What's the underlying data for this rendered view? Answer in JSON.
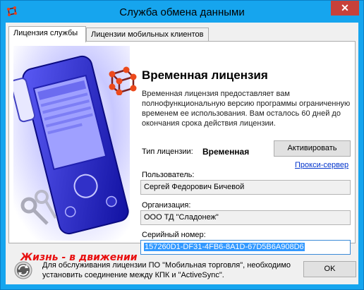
{
  "window": {
    "title": "Служба обмена данными",
    "close_glyph": "✕"
  },
  "tabs": [
    {
      "label": "Лицензия службы",
      "active": true
    },
    {
      "label": "Лицензии мобильных клиентов",
      "active": false
    }
  ],
  "license": {
    "heading": "Временная лицензия",
    "description": "Временная лицензия предоставляет вам полнофункциональную версию программы ограниченную временем ее использования. Вам осталось 60 дней до окончания срока действия лицензии.",
    "type_label": "Тип лицензии:",
    "type_value": "Временная",
    "activate_button": "Активировать",
    "proxy_link": "Прокси-сервер",
    "user_label": "Пользователь:",
    "user_value": "Сергей Федорович Бичевой",
    "org_label": "Организация:",
    "org_value": "ООО ТД \"Сладонеж\"",
    "serial_label": "Серийный номер:",
    "serial_value": "157260D1-DF31-4FB6-8A1D-67D5B6A908D6"
  },
  "art": {
    "slogan": "Жизнь - в движении"
  },
  "footer": {
    "info_text": "Для обслуживания лицензии ПО \"Мобильная торговля\", необходимо установить соединение между КПК и \"ActiveSync\".",
    "ok_button": "OK"
  },
  "colors": {
    "titlebar": "#16a5ee",
    "close": "#c7413a",
    "link": "#0033cc",
    "slogan": "#e81010",
    "selection": "#3399ff"
  },
  "icons": {
    "app": "cube-molecule-icon",
    "close": "close-icon",
    "license": "cube-molecule-icon",
    "footer": "sync-icon"
  }
}
